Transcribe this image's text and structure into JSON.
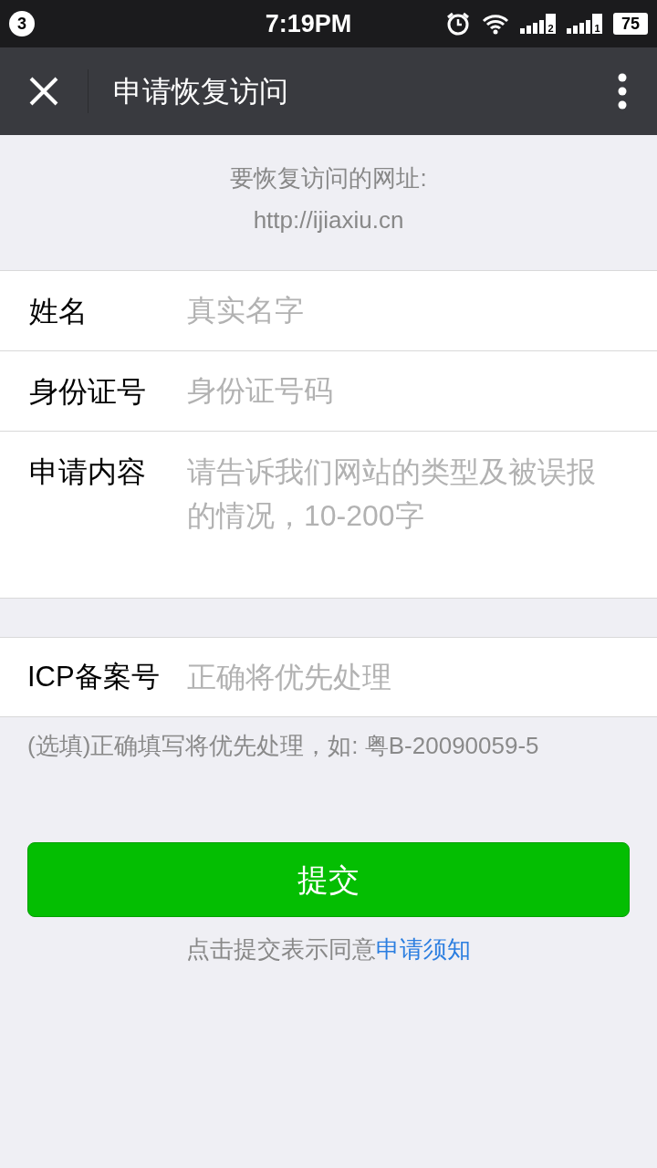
{
  "status_bar": {
    "notification_count": "3",
    "time": "7:19PM",
    "sim_1": "2",
    "sim_2": "1",
    "battery": "75"
  },
  "nav_bar": {
    "title": "申请恢复访问"
  },
  "header": {
    "caption": "要恢复访问的网址:",
    "url": "http://ijiaxiu.cn"
  },
  "form": [
    {
      "kind": "input",
      "label": "姓名",
      "placeholder": "真实名字"
    },
    {
      "kind": "input",
      "label": "身份证号",
      "placeholder": "身份证号码"
    },
    {
      "kind": "textarea",
      "label": "申请内容",
      "placeholder": "请告诉我们网站的类型及被误报的情况，10-200字"
    }
  ],
  "icp": {
    "label": "ICP备案号",
    "placeholder": "正确将优先处理",
    "hint": "(选填)正确填写将优先处理，如: 粤B-20090059-5"
  },
  "submit_button": "提交",
  "agreement": {
    "text": "点击提交表示同意",
    "link": "申请须知"
  }
}
